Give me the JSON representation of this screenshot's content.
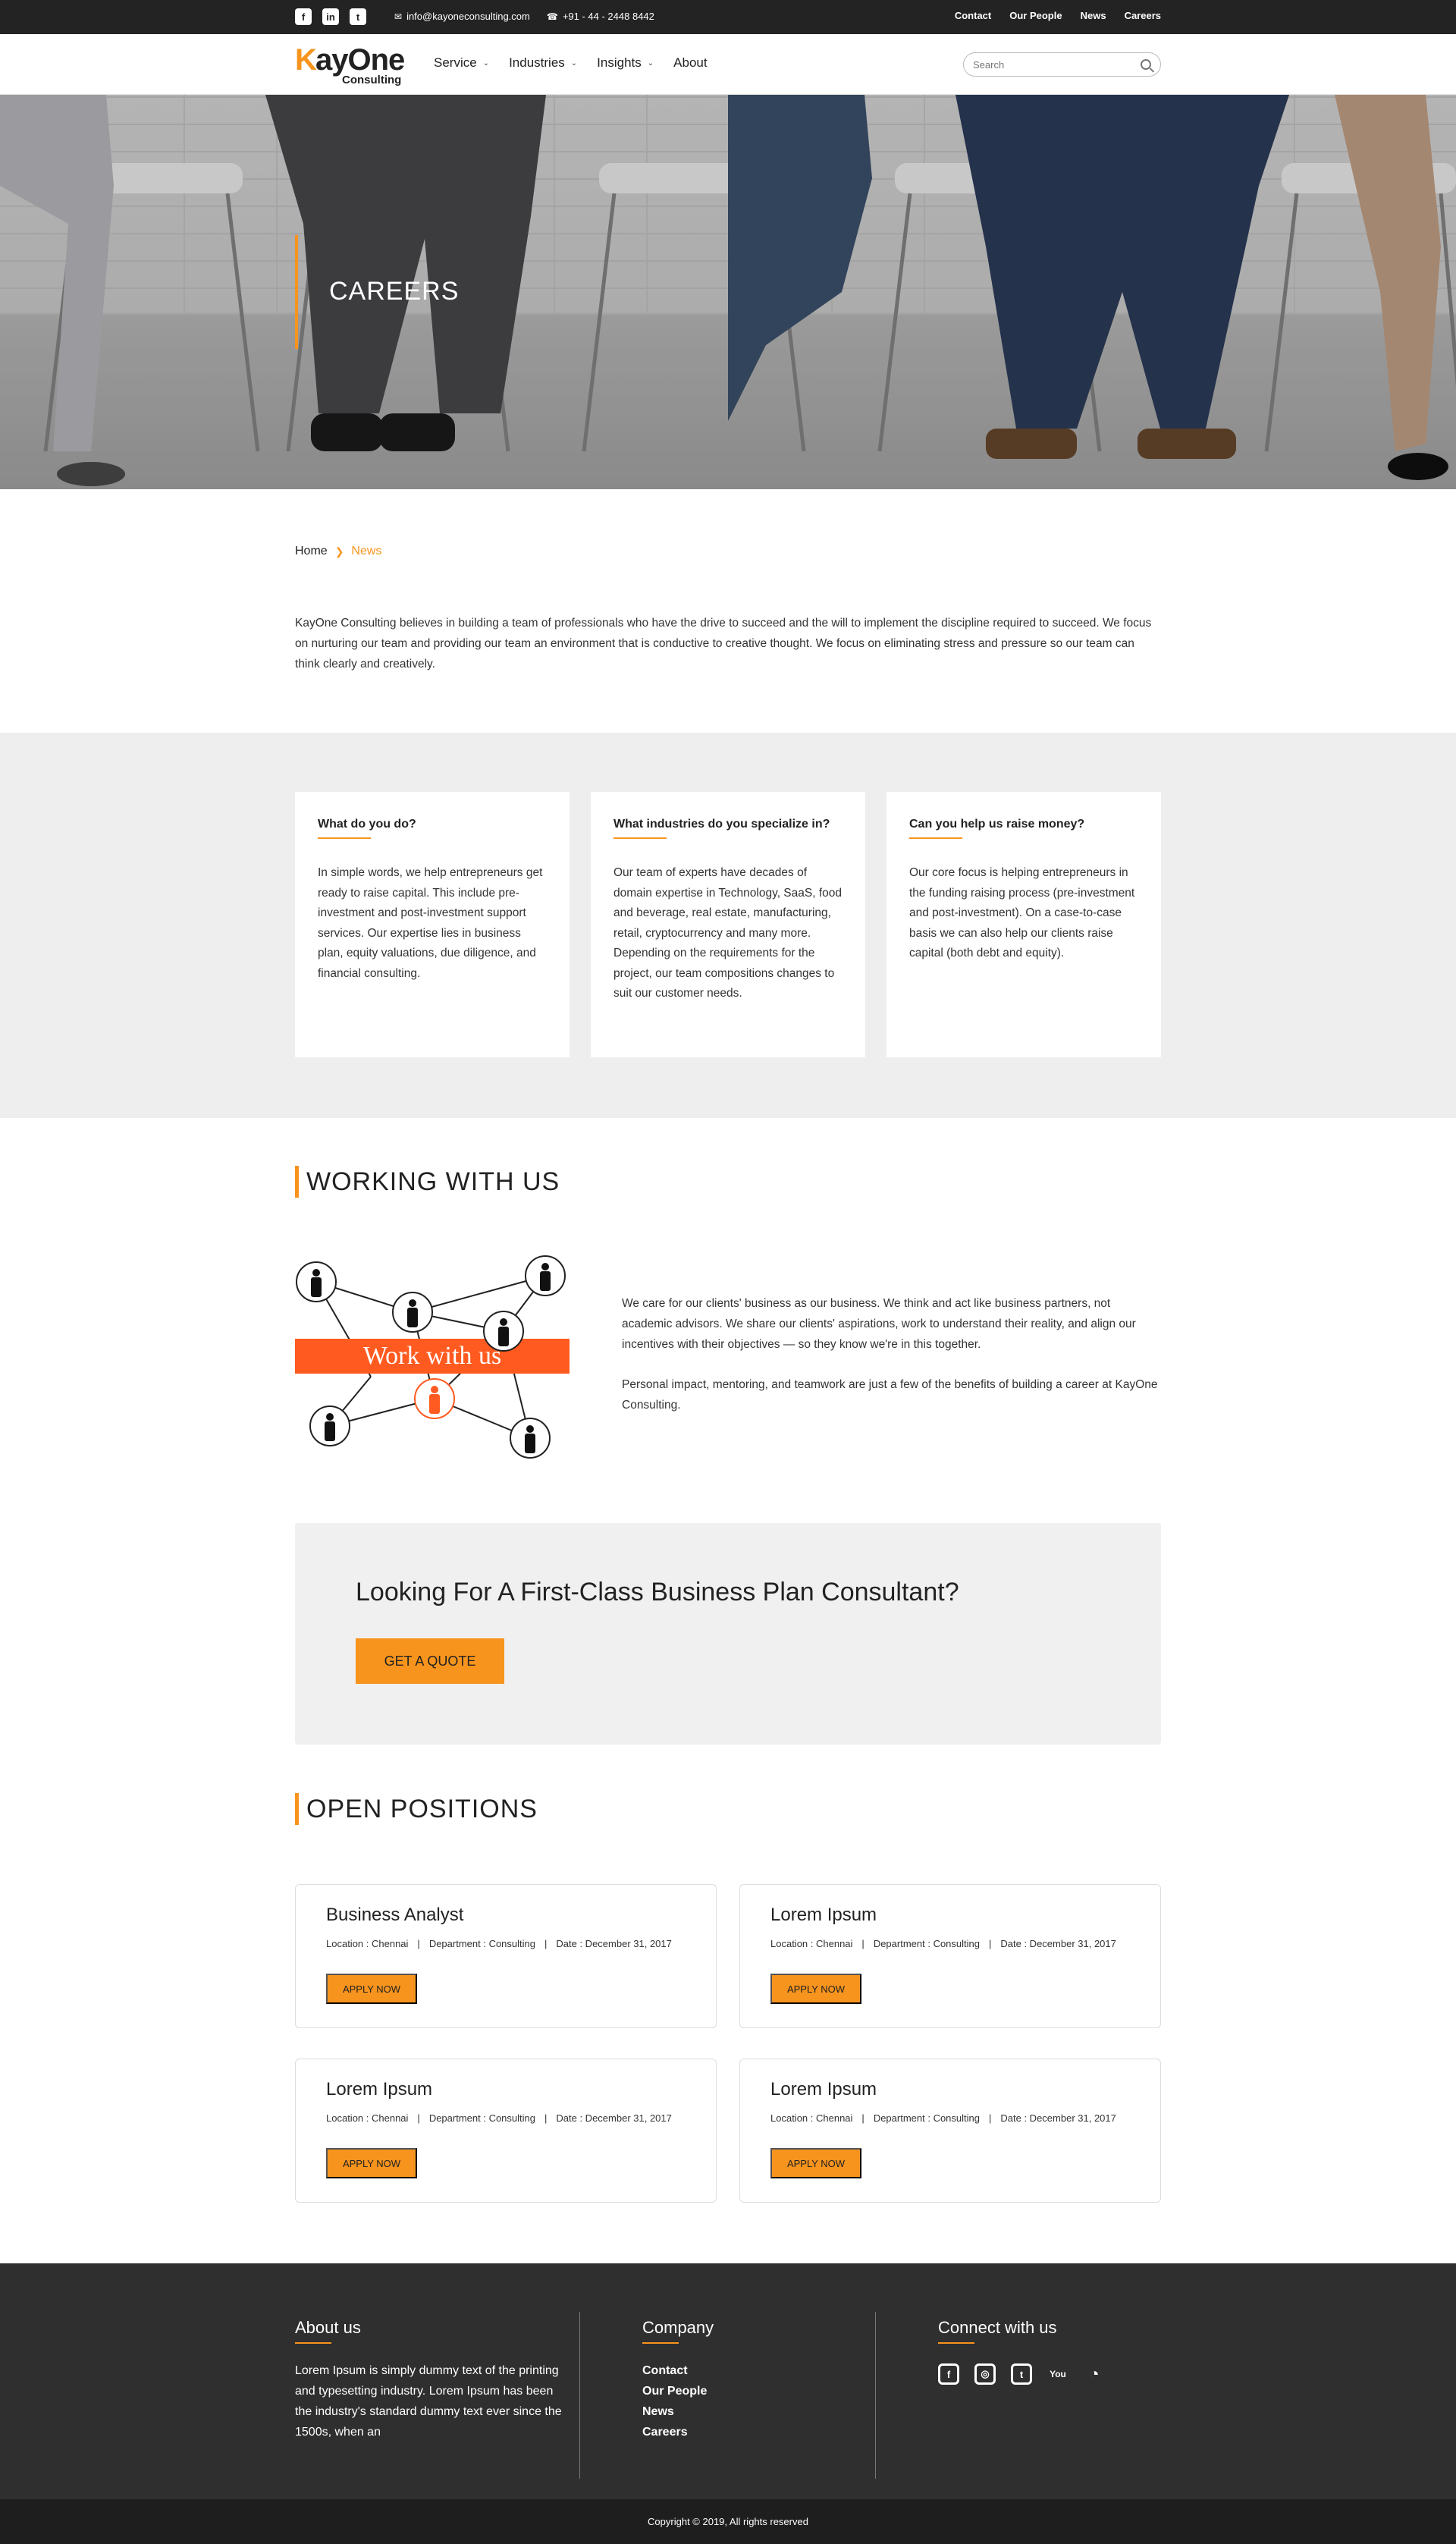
{
  "topbar": {
    "social": [
      {
        "icon": "facebook-icon",
        "glyph": "f"
      },
      {
        "icon": "linkedin-icon",
        "glyph": "in"
      },
      {
        "icon": "twitter-icon",
        "glyph": "t"
      }
    ],
    "email": "info@kayoneconsulting.com",
    "phone": "+91 - 44 - 2448 8442",
    "links": [
      "Contact",
      "Our People",
      "News",
      "Careers"
    ]
  },
  "header": {
    "logo_k": "K",
    "logo_rest": "ayOne",
    "logo_sub": "Consulting",
    "nav": [
      {
        "label": "Service",
        "dropdown": true
      },
      {
        "label": "Industries",
        "dropdown": true
      },
      {
        "label": "Insights",
        "dropdown": true
      },
      {
        "label": "About",
        "dropdown": false
      }
    ],
    "search_placeholder": "Search"
  },
  "hero": {
    "title": "CAREERS"
  },
  "breadcrumb": {
    "home": "Home",
    "current": "News"
  },
  "intro": "KayOne Consulting believes in building a team of professionals who have the drive to succeed and the will to implement the discipline required to succeed. We focus on nurturing our team and providing our team an environment that is conductive to creative thought. We focus on eliminating stress and pressure so our team can think clearly and creatively.",
  "faq": [
    {
      "title": "What do you do?",
      "body": "In simple words, we help entrepreneurs get ready to raise capital. This include pre-investment and post-investment support services. Our expertise lies in business plan, equity valuations, due diligence, and financial consulting."
    },
    {
      "title": "What industries do you specialize in?",
      "body": "Our team of experts have decades of domain expertise in Technology, SaaS, food and beverage, real estate, manufacturing, retail, cryptocurrency and many more. Depending on the requirements for the project, our team compositions changes to suit our customer needs."
    },
    {
      "title": "Can you help us raise money?",
      "body": "Our core focus is helping entrepreneurs in the funding raising process (pre-investment and post-investment). On a case-to-case basis we can also help our clients raise capital (both debt and equity)."
    }
  ],
  "working": {
    "title": "WORKING WITH US",
    "banner": "Work with us",
    "para1": "We care for our clients' business as our business. We think and act like business partners, not academic advisors. We share our clients' aspirations, work to understand their reality, and align our incentives with their objectives — so they know we're in this together.",
    "para2": "Personal impact, mentoring, and teamwork are just a few of the benefits of building a career at KayOne Consulting."
  },
  "quote": {
    "title": "Looking For A First-Class Business Plan Consultant?",
    "button": "GET A QUOTE"
  },
  "positions": {
    "title": "OPEN POSITIONS",
    "items": [
      {
        "title": "Business Analyst",
        "location": "Location : Chennai",
        "department": "Department : Consulting",
        "date": "Date :  December 31, 2017",
        "button": "APPLY NOW"
      },
      {
        "title": "Lorem Ipsum",
        "location": "Location : Chennai",
        "department": "Department : Consulting",
        "date": "Date :  December 31, 2017",
        "button": "APPLY NOW"
      },
      {
        "title": "Lorem Ipsum",
        "location": "Location : Chennai",
        "department": "Department : Consulting",
        "date": "Date :  December 31, 2017",
        "button": "APPLY NOW"
      },
      {
        "title": "Lorem Ipsum",
        "location": "Location : Chennai",
        "department": "Department : Consulting",
        "date": "Date :  December 31, 2017",
        "button": "APPLY NOW"
      }
    ]
  },
  "footer": {
    "about_title": "About us",
    "about_text": "Lorem Ipsum is simply dummy text of the printing and typesetting industry. Lorem Ipsum has been the industry's standard dummy text ever since the 1500s, when an",
    "company_title": "Company",
    "company_links": [
      "Contact",
      "Our People",
      "News",
      "Careers"
    ],
    "connect_title": "Connect with us",
    "connect_icons": [
      {
        "icon": "facebook-icon",
        "glyph": "f"
      },
      {
        "icon": "instagram-icon",
        "glyph": "◎"
      },
      {
        "icon": "twitter-icon",
        "glyph": "t"
      },
      {
        "icon": "youtube-icon",
        "glyph": "You"
      },
      {
        "icon": "rss-icon",
        "glyph": "◔"
      }
    ],
    "copyright": "Copyright © 2019, All rights reserved"
  },
  "colors": {
    "accent": "#f7941d",
    "dark": "#232323",
    "footer": "#2f2f2f",
    "band": "#eeeeee"
  }
}
